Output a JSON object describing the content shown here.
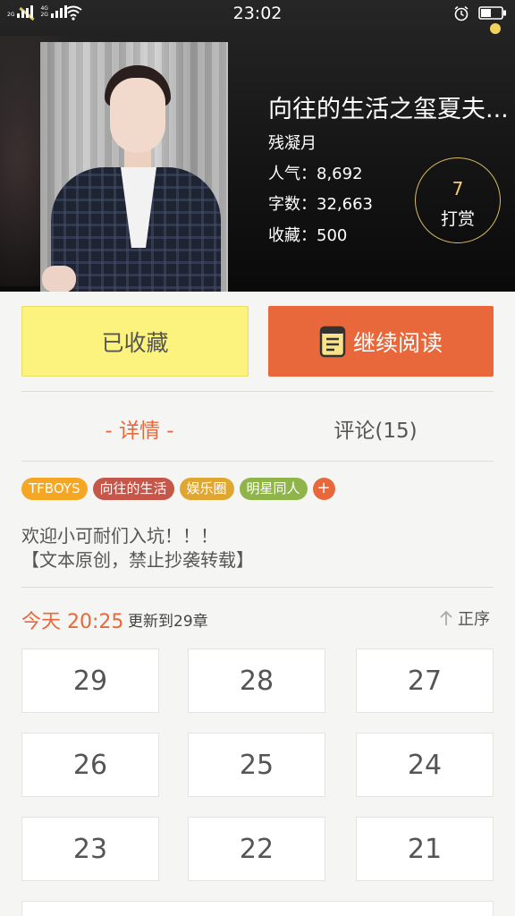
{
  "status_bar": {
    "time": "23:02",
    "sig1_label": "2G",
    "sig2_label": "4G 2G"
  },
  "book": {
    "title": "向往的生活之玺夏夫...",
    "author": "残凝月",
    "popularity": "人气：8,692",
    "word_count": "字数：32,663",
    "favorites": "收藏：500",
    "reward_count": "7",
    "reward_label": "打赏"
  },
  "actions": {
    "favorited_label": "已收藏",
    "continue_label": "继续阅读"
  },
  "tabs": {
    "detail": "- 详情 -",
    "comments": "评论(15)"
  },
  "tags": [
    {
      "label": "TFBOYS",
      "color": "#f5a623"
    },
    {
      "label": "向往的生活",
      "color": "#c4574a"
    },
    {
      "label": "娱乐圈",
      "color": "#e0a632"
    },
    {
      "label": "明星同人",
      "color": "#8fb54a"
    }
  ],
  "tag_add": "+",
  "intro": {
    "line1": "欢迎小可耐们入坑！！！",
    "line2": "【文本原创，禁止抄袭转载】"
  },
  "update": {
    "time": "今天 20:25",
    "text": "更新到29章",
    "sort_label": "正序"
  },
  "chapters": [
    "29",
    "28",
    "27",
    "26",
    "25",
    "24",
    "23",
    "22",
    "21"
  ],
  "colors": {
    "accent": "#e8683b",
    "favorite_bg": "#fcf37e",
    "reward_border": "#d9b866"
  }
}
